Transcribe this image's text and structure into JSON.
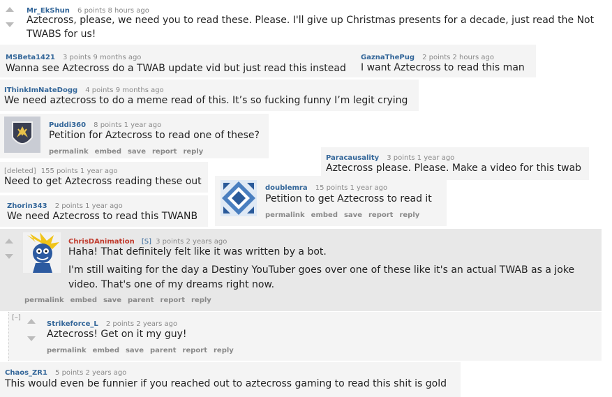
{
  "c1": {
    "user": "Mr_EkShun",
    "meta": "6 points 8 hours ago",
    "text1": "Aztecross, please, we need you to read these. Please. I'll give up Christmas presents for a decade, just read the Not",
    "text2": "TWABS for us!"
  },
  "c2": {
    "user": "MSBeta1421",
    "meta": "3 points 9 months ago",
    "text": "Wanna see Aztecross do a TWAB update vid but just read this instead"
  },
  "c3": {
    "user": "GaznaThePug",
    "meta": "2 points 2 hours ago",
    "text": "I want Aztecross to read this man"
  },
  "c4": {
    "user": "IThinkImNateDogg",
    "meta": "4 points 9 months ago",
    "text": "We need aztecross to do a meme read of this. It’s so fucking funny I’m legit crying"
  },
  "c5": {
    "user": "Puddi360",
    "meta": "8 points 1 year ago",
    "text": "Petition for Aztecross to read one of these?"
  },
  "c6": {
    "user": "Paracausality",
    "meta": "3 points 1 year ago",
    "text": "Aztecross please. Please. Make a video for this twab"
  },
  "c7": {
    "user": "[deleted]",
    "meta": "155 points 1 year ago",
    "text": "Need to get Aztecross reading these out"
  },
  "c8": {
    "user": "doublemra",
    "meta": "15 points 1 year ago",
    "text": "Petition to get Aztecross to read it"
  },
  "c9": {
    "user": "Zhorin343",
    "meta": "2 points 1 year ago",
    "text": "We need Aztecross to read this TWANB"
  },
  "c10": {
    "user": "ChrisDAnimation",
    "flair": "[S]",
    "meta": "3 points 2 years ago",
    "text1": "Haha! That definitely felt like it was written by a bot.",
    "text2": "I'm still waiting for the day a Destiny YouTuber goes over one of these like it's an actual TWAB as a joke",
    "text3": "video. That's one of my dreams right now."
  },
  "c11": {
    "collapse": "[–]",
    "user": "Strikeforce_L",
    "meta": "2 points 2 years ago",
    "text": "Aztecross! Get on it my guy!"
  },
  "c12": {
    "user": "Chaos_ZR1",
    "meta": "5 points 2 years ago",
    "text": "This would even be funnier if you reached out to aztecross gaming to read this shit is gold"
  },
  "links": {
    "permalink": "permalink",
    "embed": "embed",
    "save": "save",
    "parent": "parent",
    "report": "report",
    "reply": "reply"
  },
  "colors": {
    "username": "#336699",
    "admin_username": "#c0392b",
    "panel": "#f4f4f4",
    "highlight": "#e8e8e8"
  }
}
